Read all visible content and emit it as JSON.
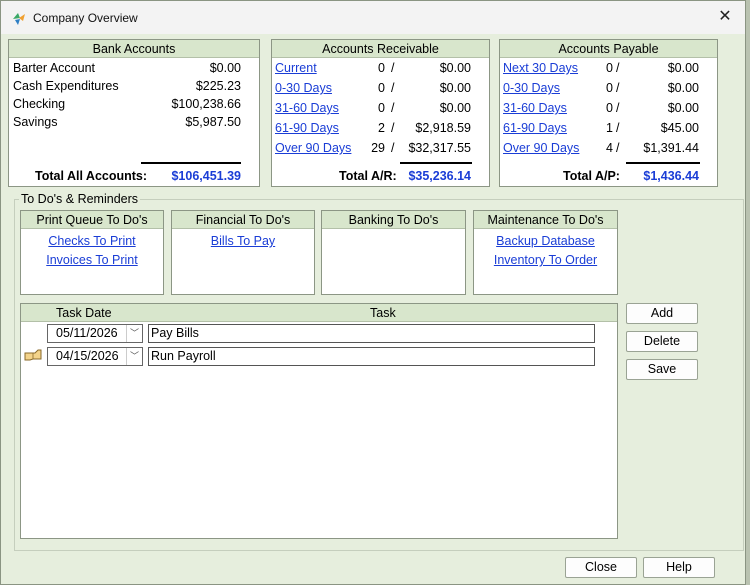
{
  "window": {
    "title": "Company Overview",
    "close_glyph": "✕"
  },
  "bank": {
    "header": "Bank Accounts",
    "rows": [
      {
        "name": "Barter Account",
        "amount": "$0.00"
      },
      {
        "name": "Cash Expenditures",
        "amount": "$225.23"
      },
      {
        "name": "Checking",
        "amount": "$100,238.66"
      },
      {
        "name": "Savings",
        "amount": "$5,987.50"
      }
    ],
    "total_label": "Total All Accounts:",
    "total_value": "$106,451.39"
  },
  "ar": {
    "header": "Accounts Receivable",
    "rows": [
      {
        "label": "Current",
        "count": "0",
        "amount": "$0.00"
      },
      {
        "label": "0-30 Days",
        "count": "0",
        "amount": "$0.00"
      },
      {
        "label": "31-60 Days",
        "count": "0",
        "amount": "$0.00"
      },
      {
        "label": "61-90 Days",
        "count": "2",
        "amount": "$2,918.59"
      },
      {
        "label": "Over 90 Days",
        "count": "29",
        "amount": "$32,317.55"
      }
    ],
    "total_label": "Total A/R:",
    "total_value": "$35,236.14"
  },
  "ap": {
    "header": "Accounts Payable",
    "rows": [
      {
        "label": "Next 30 Days",
        "count": "0",
        "amount": "$0.00"
      },
      {
        "label": "0-30 Days",
        "count": "0",
        "amount": "$0.00"
      },
      {
        "label": "31-60 Days",
        "count": "0",
        "amount": "$0.00"
      },
      {
        "label": "61-90 Days",
        "count": "1",
        "amount": "$45.00"
      },
      {
        "label": "Over 90 Days",
        "count": "4",
        "amount": "$1,391.44"
      }
    ],
    "total_label": "Total A/P:",
    "total_value": "$1,436.44"
  },
  "separator": "/",
  "todos": {
    "section_label": "To Do's & Reminders",
    "print_queue": {
      "header": "Print Queue To Do's",
      "items": [
        "Checks To Print",
        "Invoices To Print"
      ]
    },
    "financial": {
      "header": "Financial To Do's",
      "items": [
        "Bills To Pay"
      ]
    },
    "banking": {
      "header": "Banking To Do's",
      "items": []
    },
    "maintenance": {
      "header": "Maintenance To Do's",
      "items": [
        "Backup Database",
        "Inventory To Order"
      ]
    }
  },
  "tasks": {
    "col_date": "Task Date",
    "col_task": "Task",
    "rows": [
      {
        "date": "05/11/2026",
        "task": "Pay Bills"
      },
      {
        "date": "04/15/2026",
        "task": "Run Payroll"
      }
    ],
    "dropdown_glyph": "﹀"
  },
  "buttons": {
    "add": "Add",
    "delete": "Delete",
    "save": "Save",
    "close": "Close",
    "help": "Help"
  }
}
